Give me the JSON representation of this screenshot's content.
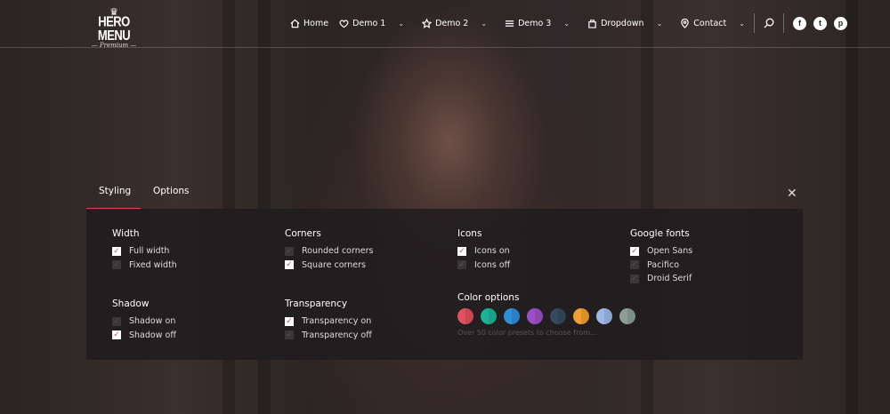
{
  "logo": {
    "title": "HERO MENU",
    "subtitle": "— Premium —"
  },
  "nav": {
    "items": [
      {
        "label": "Home",
        "icon": "home-icon",
        "dropdown": false
      },
      {
        "label": "Demo 1",
        "icon": "heart-icon",
        "dropdown": true
      },
      {
        "label": "Demo 2",
        "icon": "star-icon",
        "dropdown": true
      },
      {
        "label": "Demo 3",
        "icon": "list-icon",
        "dropdown": true
      },
      {
        "label": "Dropdown",
        "icon": "bag-icon",
        "dropdown": true
      },
      {
        "label": "Contact",
        "icon": "pin-icon",
        "dropdown": true
      }
    ],
    "social": [
      "f",
      "t",
      "p"
    ]
  },
  "tabs": [
    {
      "label": "Styling",
      "active": true
    },
    {
      "label": "Options",
      "active": false
    }
  ],
  "groups": [
    {
      "title": "Width",
      "items": [
        {
          "label": "Full width",
          "checked": true
        },
        {
          "label": "Fixed width",
          "checked": false
        }
      ]
    },
    {
      "title": "Corners",
      "items": [
        {
          "label": "Rounded corners",
          "checked": false
        },
        {
          "label": "Square corners",
          "checked": true
        }
      ]
    },
    {
      "title": "Icons",
      "items": [
        {
          "label": "Icons on",
          "checked": true
        },
        {
          "label": "Icons off",
          "checked": false
        }
      ]
    },
    {
      "title": "Google fonts",
      "items": [
        {
          "label": "Open Sans",
          "checked": true
        },
        {
          "label": "Pacifico",
          "checked": false
        },
        {
          "label": "Droid Serif",
          "checked": false
        }
      ]
    },
    {
      "title": "Shadow",
      "items": [
        {
          "label": "Shadow on",
          "checked": false
        },
        {
          "label": "Shadow off",
          "checked": true
        }
      ]
    },
    {
      "title": "Transparency",
      "items": [
        {
          "label": "Transparency on",
          "checked": true
        },
        {
          "label": "Transparency off",
          "checked": false
        }
      ]
    }
  ],
  "color_options": {
    "title": "Color options",
    "colors": [
      "#e0505e",
      "#1bb394",
      "#2e8fd8",
      "#9b4fc4",
      "#34495e",
      "#f0a030",
      "#9fb7e6",
      "#8f9c9a"
    ],
    "note": "Over 50 color presets to choose from..."
  },
  "accent": "#e0454f"
}
